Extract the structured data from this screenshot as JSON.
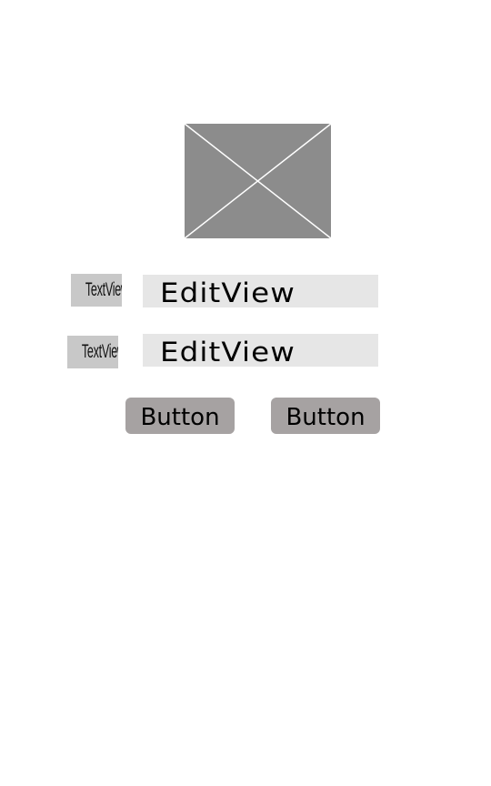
{
  "image": {
    "icon": "image-placeholder-icon",
    "background_color": "#8c8c8c",
    "cross_color": "#ffffff"
  },
  "form": {
    "rows": [
      {
        "label": "TextView",
        "input_value": "EditView"
      },
      {
        "label": "TextView",
        "input_value": "EditView"
      }
    ]
  },
  "buttons": [
    {
      "label": "Button"
    },
    {
      "label": "Button"
    }
  ],
  "colors": {
    "textview_bg": "#c8c8c8",
    "editview_bg": "#e6e6e6",
    "button_bg": "#a6a2a2"
  }
}
